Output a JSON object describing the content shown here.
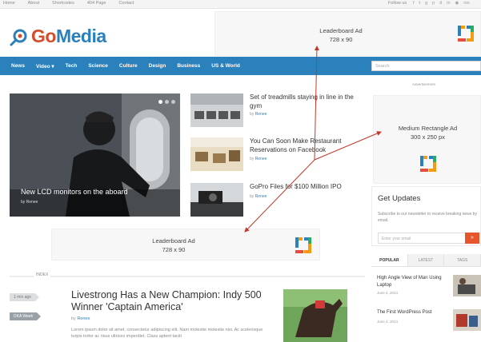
{
  "topbar": {
    "links": [
      "Home",
      "About",
      "Shortcodes",
      "404 Page",
      "Contact"
    ],
    "follow_label": "Follow us",
    "social_icons": [
      "facebook-icon",
      "twitter-icon",
      "googleplus-icon",
      "pinterest-icon",
      "dribbble-icon",
      "linkedin-icon",
      "instagram-icon",
      "rss-icon"
    ],
    "social_glyphs": [
      "f",
      "t",
      "g",
      "p",
      "d",
      "in",
      "◉",
      "rss"
    ]
  },
  "header": {
    "logo_go": "Go",
    "logo_media": "Media",
    "ad_title": "Leaderboard Ad",
    "ad_size": "728 x 90"
  },
  "nav": {
    "items": [
      "News",
      "Video ▾",
      "Tech",
      "Science",
      "Culture",
      "Design",
      "Business",
      "US & World"
    ],
    "search_placeholder": "Search"
  },
  "featured": {
    "title": "New LCD monitors on the aboard",
    "byline": "by Renee"
  },
  "side_articles": [
    {
      "title": "Set of treadmills staying in line in the gym",
      "by": "by",
      "author": "Renee"
    },
    {
      "title": "You Can Soon Make Restaurant Reservations on Facebook",
      "by": "by",
      "author": "Renee"
    },
    {
      "title": "GoPro Files for $100 Million IPO",
      "by": "by",
      "author": "Renee"
    }
  ],
  "mid_ad": {
    "title": "Leaderboard Ad",
    "size": "728 x 90"
  },
  "section": {
    "label": "INDEX",
    "tag_time": "1 min ago",
    "tag_category": "DKA Week"
  },
  "main_article": {
    "title": "Livestrong Has a New Champion: Indy 500 Winner 'Captain America'",
    "by": "by",
    "author": "Renee",
    "excerpt": "Lorem ipsum dolor sit amet, consectetur adipiscing elit. Nam molestie molestie nisi. Ac scelerisque turpis tortor ac risus ultrices imperdiet. Class aptent taciti"
  },
  "sidebar": {
    "ad_label": "Advertisement",
    "rect_ad_title": "Medium Rectangle Ad",
    "rect_ad_size": "300 x 250 px",
    "updates_title": "Get Updates",
    "updates_desc": "Subscribe to our newsletter to receive breaking news by email.",
    "email_placeholder": "Enter your email",
    "email_button": "»",
    "tabs": [
      "POPULAR",
      "LATEST",
      "TAGS"
    ],
    "popular": [
      {
        "title": "High Angle View of Man Using Laptop",
        "date": "June 4, 2014"
      },
      {
        "title": "The First WordPress Post",
        "date": "June 4, 2014"
      }
    ]
  },
  "colors": {
    "brand_blue": "#2a81bc",
    "accent_orange": "#e7552c",
    "annotation_red": "#c0392b"
  }
}
